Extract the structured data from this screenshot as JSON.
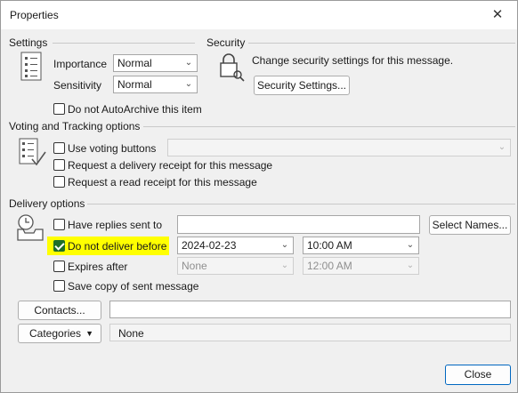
{
  "window": {
    "title": "Properties",
    "close_glyph": "✕"
  },
  "settings": {
    "group_label": "Settings",
    "importance_label": "Importance",
    "importance_value": "Normal",
    "sensitivity_label": "Sensitivity",
    "sensitivity_value": "Normal",
    "autoarchive_label": "Do not AutoArchive this item",
    "autoarchive_checked": false
  },
  "security": {
    "group_label": "Security",
    "description": "Change security settings for this message.",
    "button_label": "Security Settings..."
  },
  "voting": {
    "group_label": "Voting and Tracking options",
    "use_voting_label": "Use voting buttons",
    "use_voting_checked": false,
    "voting_value": "",
    "delivery_receipt_label": "Request a delivery receipt for this message",
    "delivery_receipt_checked": false,
    "read_receipt_label": "Request a read receipt for this message",
    "read_receipt_checked": false
  },
  "delivery": {
    "group_label": "Delivery options",
    "replies_label": "Have replies sent to",
    "replies_checked": false,
    "replies_value": "",
    "select_names_label": "Select Names...",
    "deliver_label": "Do not deliver before",
    "deliver_checked": true,
    "deliver_date": "2024-02-23",
    "deliver_time": "10:00 AM",
    "expires_label": "Expires after",
    "expires_checked": false,
    "expires_date": "None",
    "expires_time": "12:00 AM",
    "save_copy_label": "Save copy of sent message",
    "save_copy_checked": false
  },
  "footer": {
    "contacts_label": "Contacts...",
    "contacts_value": "",
    "categories_label": "Categories",
    "categories_value": "None",
    "close_label": "Close"
  },
  "colors": {
    "highlight": "#ffff00",
    "checked": "#1f6f29",
    "accent": "#0067c0"
  }
}
